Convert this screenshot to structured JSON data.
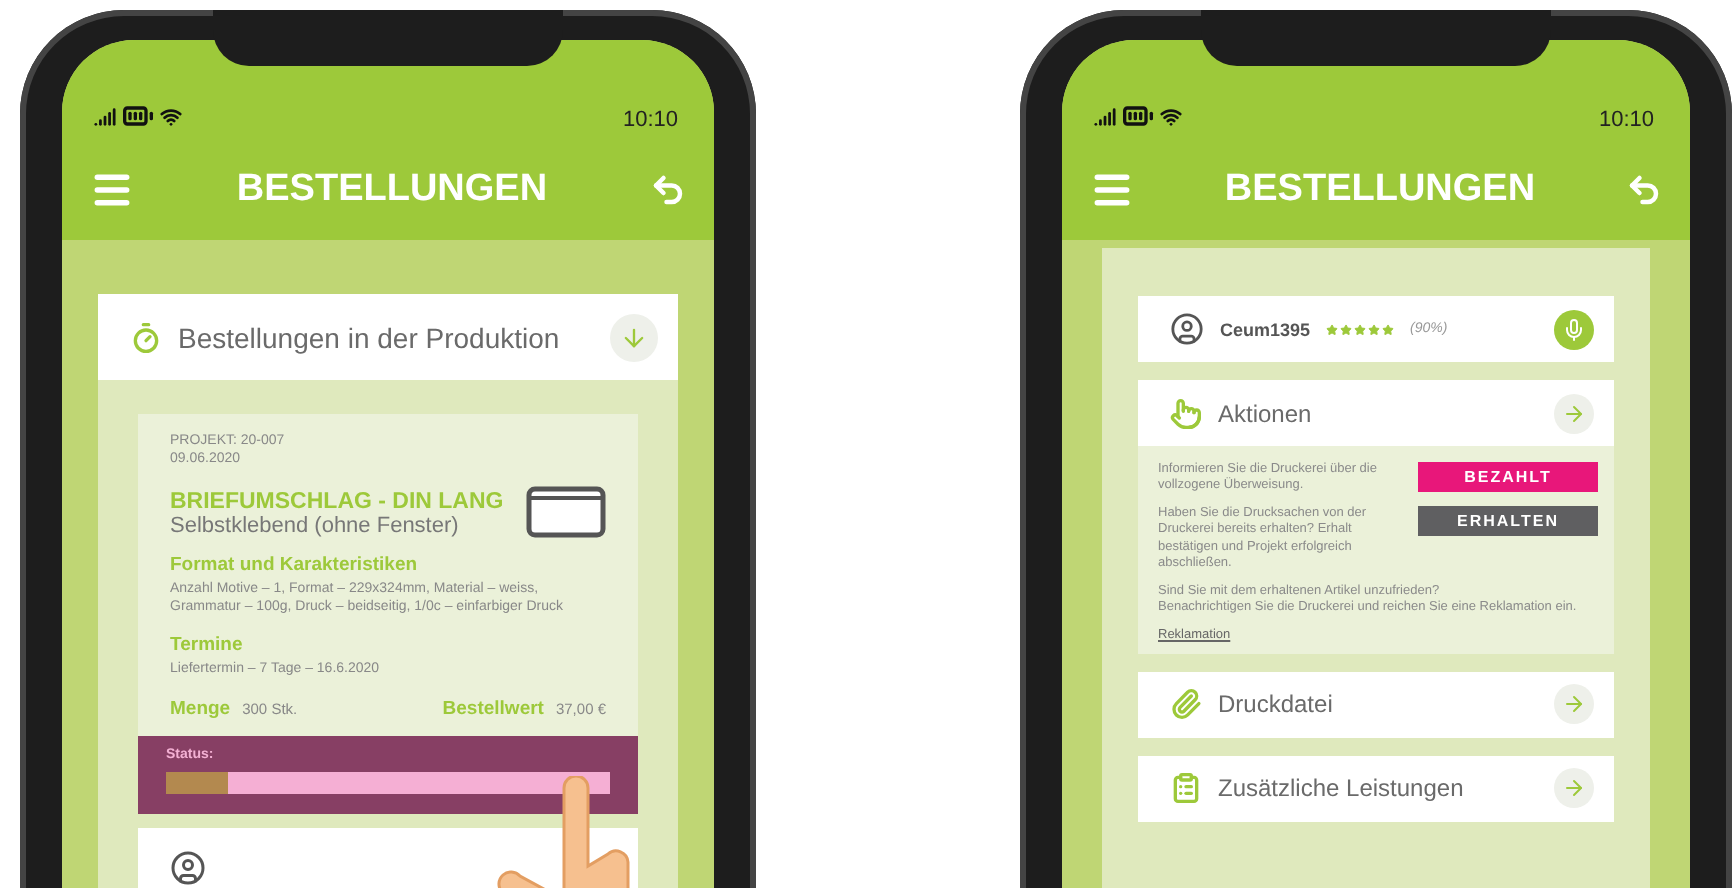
{
  "production_screen": {
    "status_bar": {
      "time": "10:10"
    },
    "header": {
      "title": "BESTELLUNGEN"
    },
    "section": {
      "title": "Bestellungen in der Produktion"
    },
    "order": {
      "project": "PROJEKT: 20-007",
      "date": "09.06.2020",
      "product": "BRIEFUMSCHLAG - DIN LANG",
      "subtitle": "Selbstklebend (ohne Fenster)",
      "details": [
        {
          "heading": "Format und Karakteristiken",
          "text": "Anzahl Motive – 1, Format – 229x324mm, Material – weiss, Grammatur – 100g, Druck – beidseitig, 1/0c – einfarbiger Druck"
        },
        {
          "heading": "Termine",
          "text": "Liefertermin – 7 Tage – 16.6.2020"
        }
      ],
      "quantity_label": "Menge",
      "quantity": "300 Stk.",
      "value_label": "Bestellwert",
      "value": "37,00 €",
      "status": {
        "label": "Status:",
        "level": 0.14
      }
    }
  },
  "detail_screen": {
    "status_bar": {
      "time": "10:10"
    },
    "header": {
      "title": "BESTELLUNGEN"
    },
    "seller": {
      "name": "Ceum1395",
      "stars": 5,
      "rating": "(90%)"
    },
    "actions": {
      "title": "Aktionen",
      "items": [
        {
          "text": "Informieren Sie die Druckerei über die vollzogene Überweisung.",
          "button": "BEZAHLT",
          "color": "#e8177a"
        },
        {
          "text": "Haben Sie die Drucksachen von der Druckerei bereits erhalten? Erhalt bestätigen und Projekt erfolgreich abschließen.",
          "button": "ERHALTEN",
          "color": "#5f5f61"
        }
      ],
      "complaint": {
        "lines": [
          "Sind Sie mit dem erhaltenen Artikel unzufrieden?",
          "Benachrichtigen Sie die Druckerei und reichen Sie eine Reklamation ein."
        ],
        "link": "Reklamation"
      }
    },
    "links": [
      {
        "title": "Druckdatei",
        "kind": "clip"
      },
      {
        "title": "Zusätzliche Leistungen",
        "kind": "list"
      }
    ]
  }
}
